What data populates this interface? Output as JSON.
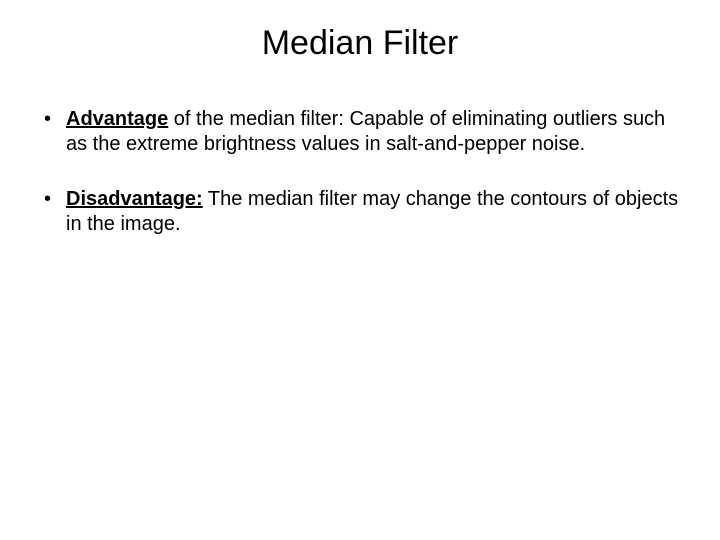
{
  "slide": {
    "title": "Median Filter",
    "bullets": [
      {
        "lead": "Advantage",
        "rest": " of the median filter: Capable of eliminating outliers such as the extreme brightness values in salt-and-pepper noise."
      },
      {
        "lead": "Disadvantage:",
        "rest": " The median filter may change the contours of objects in the image."
      }
    ]
  }
}
